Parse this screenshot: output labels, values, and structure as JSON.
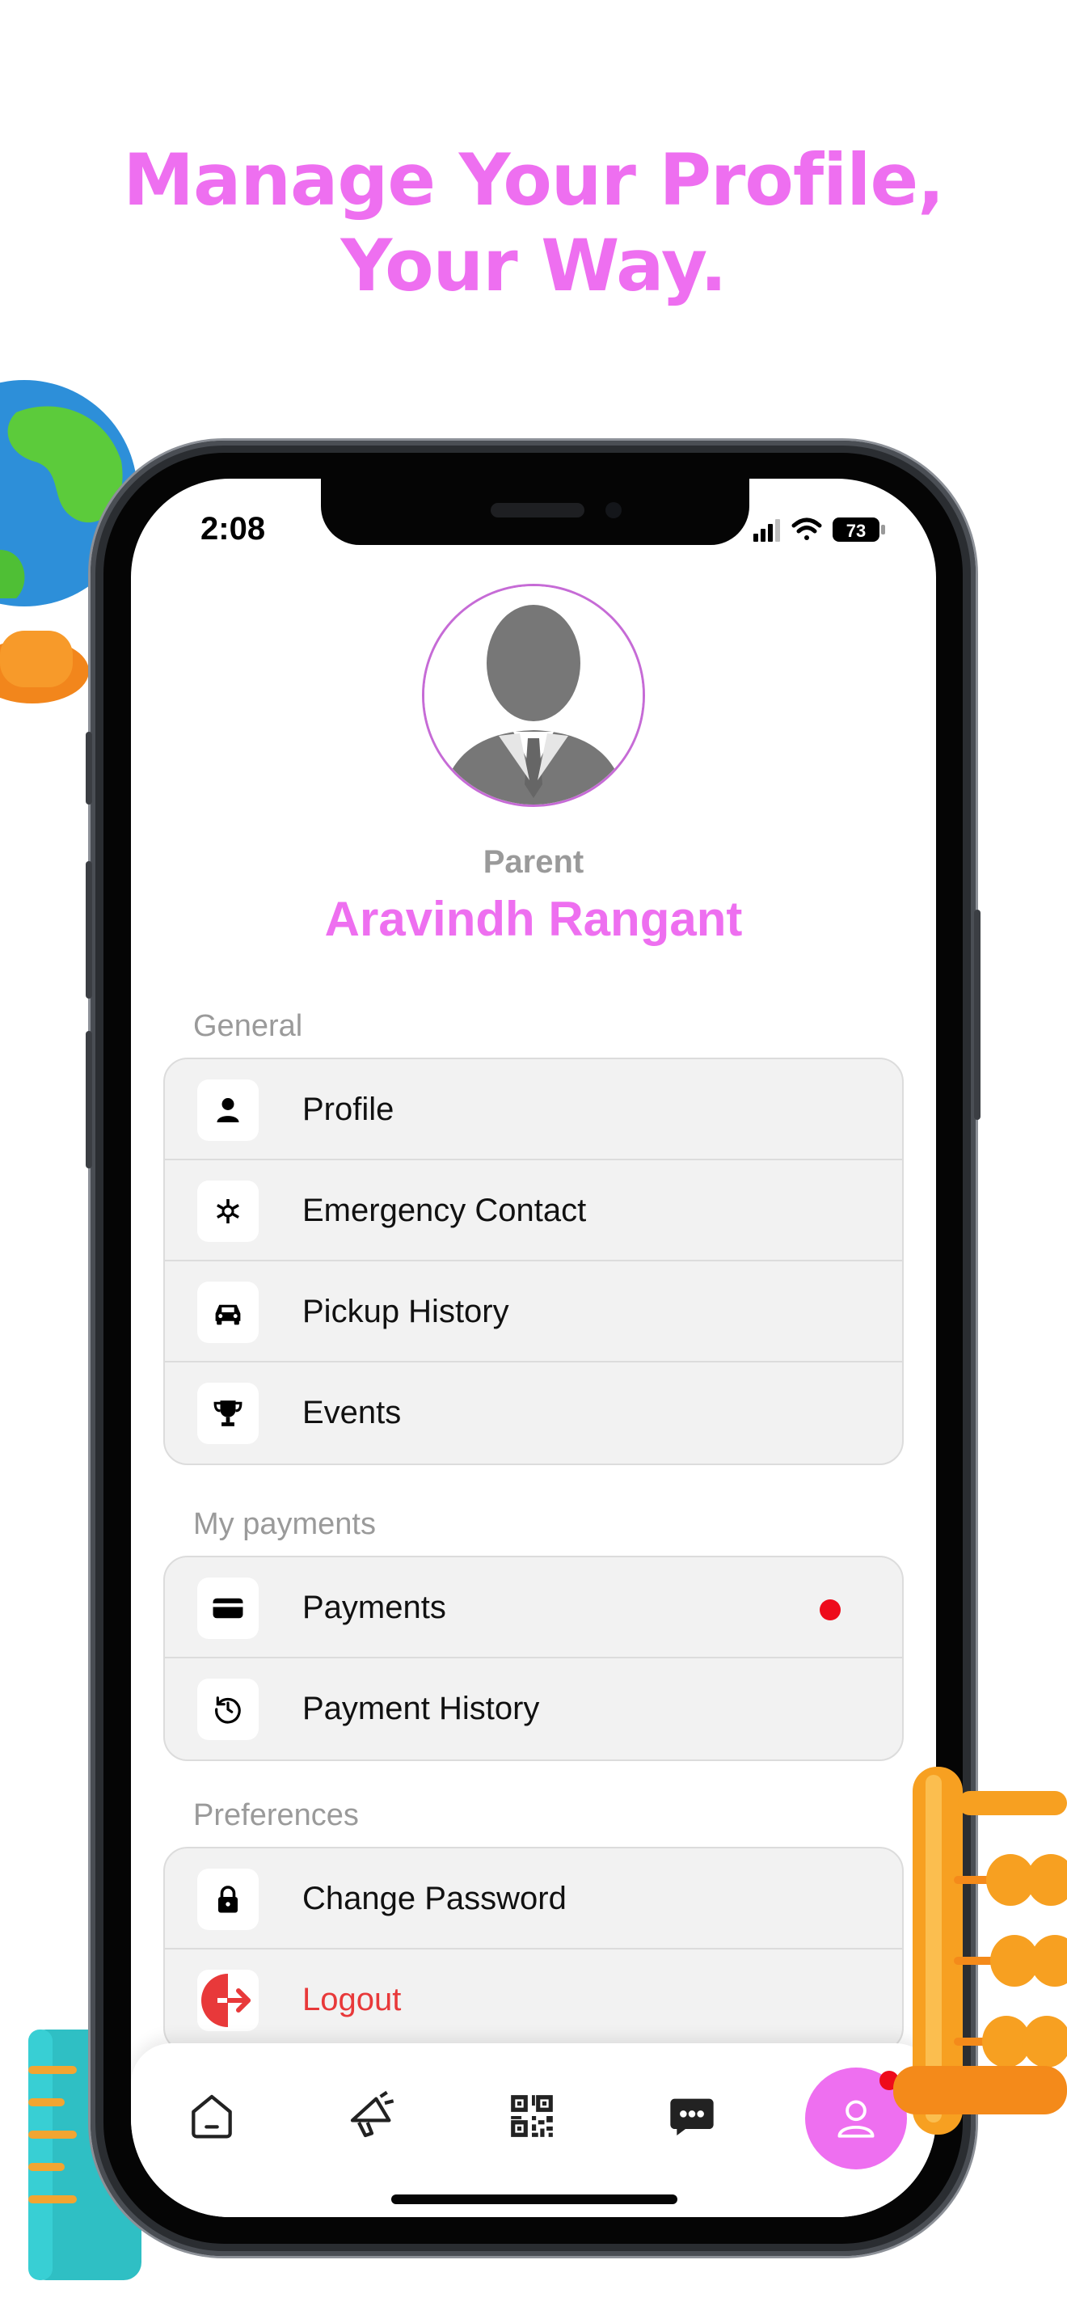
{
  "headline": {
    "line1": "Manage Your Profile,",
    "line2": "Your Way."
  },
  "status_bar": {
    "time": "2:08",
    "battery": "73"
  },
  "profile": {
    "role": "Parent",
    "name": "Aravindh Rangant"
  },
  "sections": {
    "general": {
      "title": "General",
      "items": [
        {
          "label": "Profile",
          "icon": "person-icon"
        },
        {
          "label": "Emergency Contact",
          "icon": "medical-star-icon"
        },
        {
          "label": "Pickup History",
          "icon": "car-icon"
        },
        {
          "label": "Events",
          "icon": "trophy-icon"
        }
      ]
    },
    "payments": {
      "title": "My payments",
      "items": [
        {
          "label": "Payments",
          "icon": "card-icon",
          "has_notification": true
        },
        {
          "label": "Payment History",
          "icon": "history-icon"
        }
      ]
    },
    "preferences": {
      "title": "Preferences",
      "items": [
        {
          "label": "Change Password",
          "icon": "lock-icon"
        },
        {
          "label": "Logout",
          "icon": "logout-icon"
        }
      ]
    }
  },
  "tab_bar": {
    "tabs": [
      "home-icon",
      "megaphone-icon",
      "qr-code-icon",
      "chat-icon",
      "profile-icon"
    ],
    "active": "profile-icon"
  },
  "colors": {
    "accent": "#ee6ff0",
    "danger": "#e8393a",
    "notification": "#ee0b1b"
  }
}
